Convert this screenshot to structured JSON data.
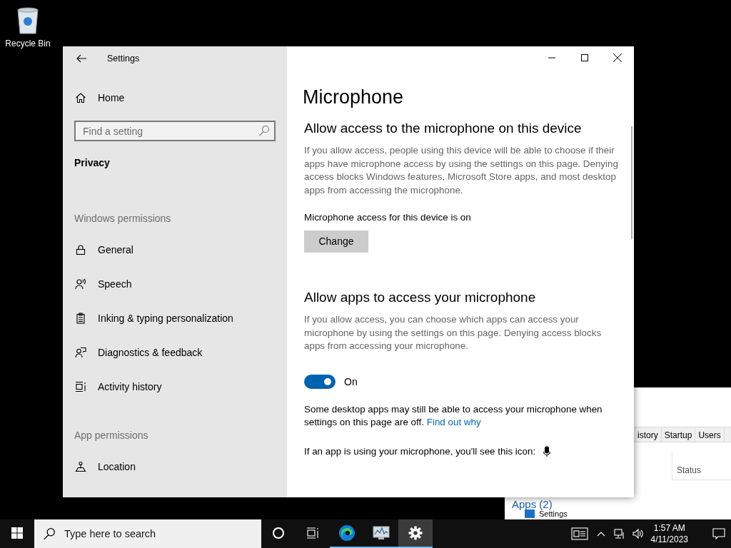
{
  "desktop_icons": [
    {
      "label": "Recycle Bin"
    }
  ],
  "settings_window": {
    "title": "Settings",
    "sidebar": {
      "home": "Home",
      "search_placeholder": "Find a setting",
      "section_title": "Privacy",
      "groups": [
        {
          "heading": "Windows permissions",
          "items": [
            {
              "label": "General",
              "kind": "lock",
              "selected": false
            },
            {
              "label": "Speech",
              "kind": "speech",
              "selected": false
            },
            {
              "label": "Inking & typing personalization",
              "kind": "clipboard",
              "selected": false
            },
            {
              "label": "Diagnostics & feedback",
              "kind": "feedback",
              "selected": false
            },
            {
              "label": "Activity history",
              "kind": "activity",
              "selected": false
            }
          ]
        },
        {
          "heading": "App permissions",
          "items": [
            {
              "label": "Location",
              "kind": "location",
              "selected": false
            }
          ]
        }
      ]
    },
    "page": {
      "title": "Microphone",
      "blocks": [
        {
          "kind": "heading",
          "text": "Allow access to the microphone on this device"
        },
        {
          "kind": "description",
          "text": "If you allow access, people using this device will be able to choose if their apps have microphone access by using the settings on this page. Denying access blocks Windows features, Microsoft Store apps, and most desktop apps from accessing the microphone."
        },
        {
          "kind": "status",
          "text": "Microphone access for this device is on"
        },
        {
          "kind": "button",
          "text": "Change"
        },
        {
          "kind": "heading",
          "text": "Allow apps to access your microphone"
        },
        {
          "kind": "description",
          "text": "If you allow access, you can choose which apps can access your microphone by using the settings on this page. Denying access blocks apps from accessing your microphone."
        },
        {
          "kind": "toggle",
          "on": true,
          "text": "On"
        },
        {
          "kind": "note",
          "text": "Some desktop apps may still be able to access your microphone when settings on this page are off.",
          "link": "Find out why"
        },
        {
          "kind": "icon_note",
          "text": "If an app is using your microphone, you'll see this icon:"
        }
      ]
    }
  },
  "background_window": {
    "tabs": [
      "istory",
      "Startup",
      "Users"
    ],
    "column": "Status",
    "group": "Apps (2)",
    "row": "Settings"
  },
  "taskbar": {
    "search_placeholder": "Type here to search",
    "apps": [
      {
        "kind": "cortana",
        "running": false,
        "selected": false
      },
      {
        "kind": "taskview",
        "running": false,
        "selected": false
      },
      {
        "kind": "edge",
        "running": true,
        "selected": false
      },
      {
        "kind": "taskmanager",
        "running": true,
        "selected": false
      },
      {
        "kind": "settings",
        "running": true,
        "selected": true
      }
    ],
    "time": "1:57 AM",
    "date": "4/11/2023"
  }
}
